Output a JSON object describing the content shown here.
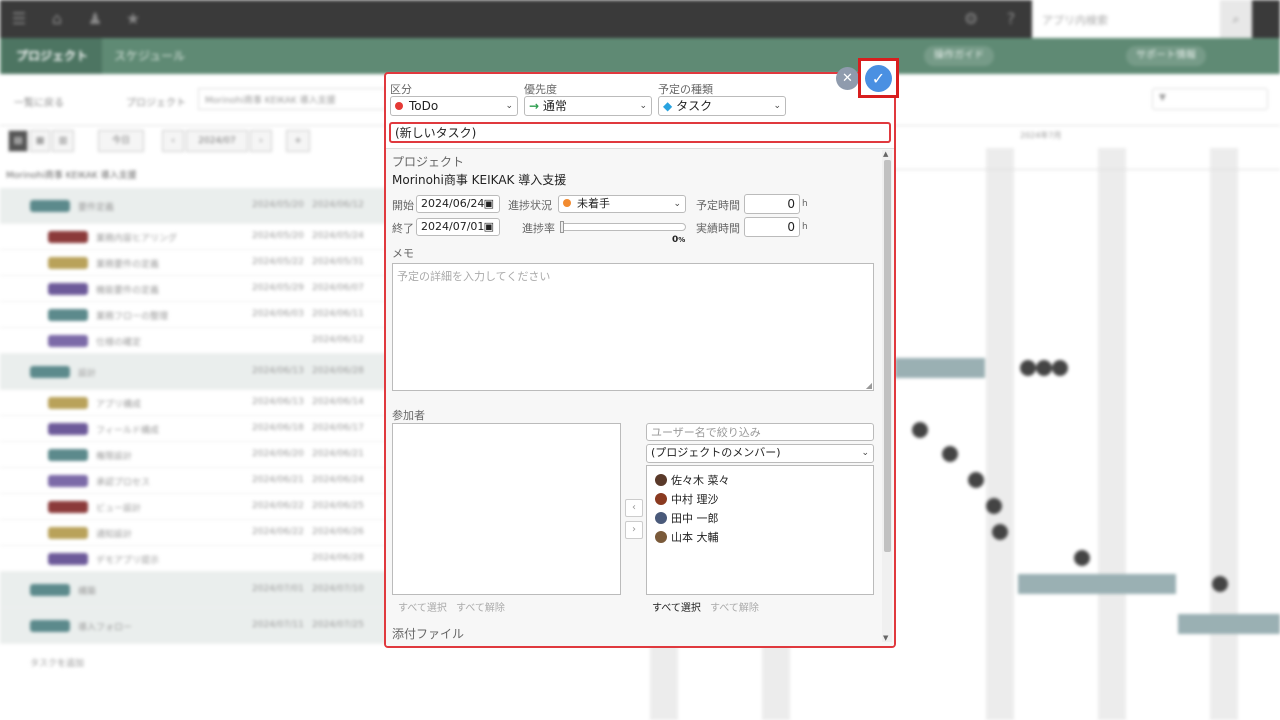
{
  "background": {
    "search_placeholder": "アプリ内検索",
    "nav_tabs": [
      "プロジェクト",
      "スケジュール"
    ],
    "nav_pills": [
      "操作ガイド",
      "サポート情報"
    ],
    "breadcrumb_back": "一覧に戻る",
    "breadcrumb_label": "プロジェクト",
    "project_box": "Morinohi商事 KEIKAK 導入支援",
    "today_btn": "今日",
    "month_btn": "2024/07",
    "list_title": "Morinohi商事 KEIKAK 導入支援",
    "gantt_month": "2024年7月",
    "rows": [
      {
        "type": "grp",
        "label": "要件定義",
        "start": "2024/05/20",
        "end": "2024/06/12"
      },
      {
        "type": "item",
        "label": "業務内容ヒアリング",
        "start": "2024/05/20",
        "end": "2024/05/24"
      },
      {
        "type": "item",
        "label": "業務要件の定義",
        "start": "2024/05/22",
        "end": "2024/05/31"
      },
      {
        "type": "item",
        "label": "機能要件の定義",
        "start": "2024/05/29",
        "end": "2024/06/07"
      },
      {
        "type": "item",
        "label": "業務フローの整理",
        "start": "2024/06/03",
        "end": "2024/06/11"
      },
      {
        "type": "item",
        "label": "仕様の確定",
        "start": "",
        "end": "2024/06/12"
      },
      {
        "type": "grp",
        "label": "設計",
        "start": "2024/06/13",
        "end": "2024/06/28"
      },
      {
        "type": "item",
        "label": "アプリ構成",
        "start": "2024/06/13",
        "end": "2024/06/14"
      },
      {
        "type": "item",
        "label": "フィールド構成",
        "start": "2024/06/18",
        "end": "2024/06/17"
      },
      {
        "type": "item",
        "label": "権限設計",
        "start": "2024/06/20",
        "end": "2024/06/21"
      },
      {
        "type": "item",
        "label": "承認プロセス",
        "start": "2024/06/21",
        "end": "2024/06/24"
      },
      {
        "type": "item",
        "label": "ビュー設計",
        "start": "2024/06/22",
        "end": "2024/06/25"
      },
      {
        "type": "item",
        "label": "通知設計",
        "start": "2024/06/22",
        "end": "2024/06/26"
      },
      {
        "type": "item",
        "label": "デモアプリ提示",
        "start": "",
        "end": "2024/06/28"
      },
      {
        "type": "grp",
        "label": "構築",
        "start": "2024/07/01",
        "end": "2024/07/10"
      },
      {
        "type": "grp",
        "label": "導入フォロー",
        "start": "2024/07/11",
        "end": "2024/07/25"
      }
    ],
    "add_task": "タスクを追加"
  },
  "dialog": {
    "category": {
      "label": "区分",
      "value": "ToDo",
      "dot_color": "#e53935"
    },
    "priority": {
      "label": "優先度",
      "value": "通常",
      "arrow_color": "#2e9e4f"
    },
    "schedule_type": {
      "label": "予定の種類",
      "value": "タスク",
      "icon_color": "#29a3e0"
    },
    "title_input": "(新しいタスク)",
    "project": {
      "label": "プロジェクト",
      "value": "Morinohi商事 KEIKAK 導入支援"
    },
    "start": {
      "label": "開始",
      "value": "2024/06/24"
    },
    "end": {
      "label": "終了",
      "value": "2024/07/01"
    },
    "progress_status": {
      "label": "進捗状況",
      "value": "未着手",
      "dot_color": "#f28b30"
    },
    "progress_rate": {
      "label": "進捗率",
      "value": "0",
      "unit": "%"
    },
    "planned_hours": {
      "label": "予定時間",
      "value": "0",
      "unit": "h"
    },
    "actual_hours": {
      "label": "実績時間",
      "value": "0",
      "unit": "h"
    },
    "memo": {
      "label": "メモ",
      "placeholder": "予定の詳細を入力してください"
    },
    "participants": {
      "label": "参加者",
      "filter_placeholder": "ユーザー名で絞り込み",
      "group_select": "(プロジェクトのメンバー)",
      "members": [
        "佐々木 菜々",
        "中村 理沙",
        "田中 一郎",
        "山本 大輔"
      ],
      "left_select_all": "すべて選択",
      "left_deselect_all": "すべて解除",
      "right_select_all": "すべて選択",
      "right_deselect_all": "すべて解除"
    },
    "attachments_label": "添付ファイル",
    "close_icon": "close-icon",
    "confirm_icon": "check-icon"
  }
}
